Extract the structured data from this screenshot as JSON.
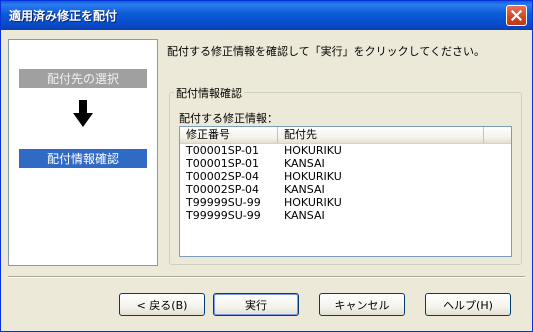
{
  "window": {
    "title": "適用済み修正を配付"
  },
  "steps": [
    {
      "label": "配付先の選択",
      "state": "done"
    },
    {
      "label": "配付情報確認",
      "state": "current"
    }
  ],
  "instruction": "配付する修正情報を確認して「実行」をクリックしてください。",
  "group": {
    "legend": "配付情報確認",
    "list_label": "配付する修正情報：",
    "columns": [
      "修正番号",
      "配付先"
    ],
    "rows": [
      [
        "T00001SP-01",
        "HOKURIKU"
      ],
      [
        "T00001SP-01",
        "KANSAI"
      ],
      [
        "T00002SP-04",
        "HOKURIKU"
      ],
      [
        "T00002SP-04",
        "KANSAI"
      ],
      [
        "T99999SU-99",
        "HOKURIKU"
      ],
      [
        "T99999SU-99",
        "KANSAI"
      ]
    ]
  },
  "buttons": {
    "back": "< 戻る(B)",
    "run": "実行",
    "cancel": "キャンセル",
    "help": "ヘルプ(H)"
  },
  "colors": {
    "titlebar": "#0a5fd8",
    "step_current": "#316ac5",
    "step_done": "#a0a0a0",
    "dialog_bg": "#ece9d8"
  },
  "icons": {
    "close": "close-icon",
    "arrow": "arrow-down-icon"
  }
}
